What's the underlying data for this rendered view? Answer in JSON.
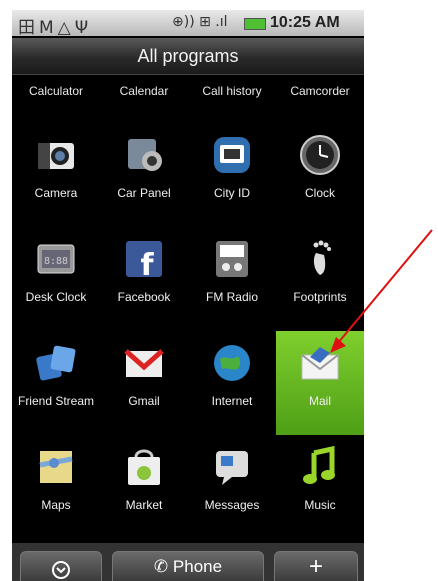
{
  "status_bar": {
    "left_icons": "田M△Ψ",
    "mid_icons": "⊕)) ⊞ .ıl",
    "time": "10:25 AM"
  },
  "title": "All programs",
  "top_row": [
    "Calculator",
    "Calendar",
    "Call history",
    "Camcorder"
  ],
  "apps": [
    {
      "label": "Camera",
      "icon": "camera-icon"
    },
    {
      "label": "Car Panel",
      "icon": "car-panel-icon"
    },
    {
      "label": "City ID",
      "icon": "city-id-icon"
    },
    {
      "label": "Clock",
      "icon": "clock-icon"
    },
    {
      "label": "Desk Clock",
      "icon": "desk-clock-icon"
    },
    {
      "label": "Facebook",
      "icon": "facebook-icon"
    },
    {
      "label": "FM Radio",
      "icon": "fm-radio-icon"
    },
    {
      "label": "Footprints",
      "icon": "footprints-icon"
    },
    {
      "label": "Friend Stream",
      "icon": "friend-stream-icon"
    },
    {
      "label": "Gmail",
      "icon": "gmail-icon"
    },
    {
      "label": "Internet",
      "icon": "globe-icon"
    },
    {
      "label": "Mail",
      "icon": "mail-icon"
    },
    {
      "label": "Maps",
      "icon": "maps-icon"
    },
    {
      "label": "Market",
      "icon": "market-icon"
    },
    {
      "label": "Messages",
      "icon": "messages-icon"
    },
    {
      "label": "Music",
      "icon": "music-note-icon"
    }
  ],
  "dock": {
    "phone_label": "Phone",
    "left_icon": "circle-chevron-icon",
    "right_icon": "plus-icon",
    "right_glyph": "+"
  },
  "annotation": {
    "color": "#e01010"
  }
}
